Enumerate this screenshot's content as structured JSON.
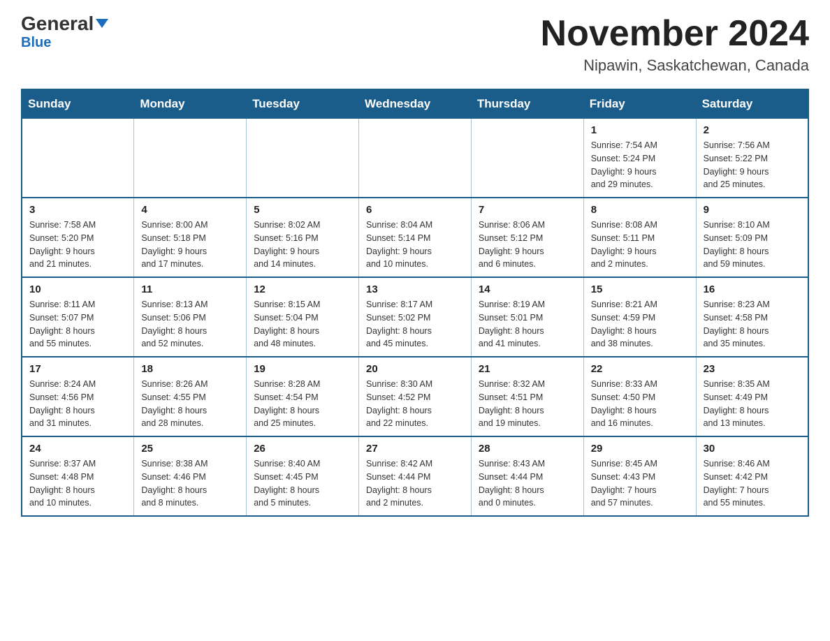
{
  "header": {
    "logo_general": "General",
    "logo_blue": "Blue",
    "month_title": "November 2024",
    "location": "Nipawin, Saskatchewan, Canada"
  },
  "days_of_week": [
    "Sunday",
    "Monday",
    "Tuesday",
    "Wednesday",
    "Thursday",
    "Friday",
    "Saturday"
  ],
  "weeks": [
    [
      {
        "day": "",
        "info": ""
      },
      {
        "day": "",
        "info": ""
      },
      {
        "day": "",
        "info": ""
      },
      {
        "day": "",
        "info": ""
      },
      {
        "day": "",
        "info": ""
      },
      {
        "day": "1",
        "info": "Sunrise: 7:54 AM\nSunset: 5:24 PM\nDaylight: 9 hours\nand 29 minutes."
      },
      {
        "day": "2",
        "info": "Sunrise: 7:56 AM\nSunset: 5:22 PM\nDaylight: 9 hours\nand 25 minutes."
      }
    ],
    [
      {
        "day": "3",
        "info": "Sunrise: 7:58 AM\nSunset: 5:20 PM\nDaylight: 9 hours\nand 21 minutes."
      },
      {
        "day": "4",
        "info": "Sunrise: 8:00 AM\nSunset: 5:18 PM\nDaylight: 9 hours\nand 17 minutes."
      },
      {
        "day": "5",
        "info": "Sunrise: 8:02 AM\nSunset: 5:16 PM\nDaylight: 9 hours\nand 14 minutes."
      },
      {
        "day": "6",
        "info": "Sunrise: 8:04 AM\nSunset: 5:14 PM\nDaylight: 9 hours\nand 10 minutes."
      },
      {
        "day": "7",
        "info": "Sunrise: 8:06 AM\nSunset: 5:12 PM\nDaylight: 9 hours\nand 6 minutes."
      },
      {
        "day": "8",
        "info": "Sunrise: 8:08 AM\nSunset: 5:11 PM\nDaylight: 9 hours\nand 2 minutes."
      },
      {
        "day": "9",
        "info": "Sunrise: 8:10 AM\nSunset: 5:09 PM\nDaylight: 8 hours\nand 59 minutes."
      }
    ],
    [
      {
        "day": "10",
        "info": "Sunrise: 8:11 AM\nSunset: 5:07 PM\nDaylight: 8 hours\nand 55 minutes."
      },
      {
        "day": "11",
        "info": "Sunrise: 8:13 AM\nSunset: 5:06 PM\nDaylight: 8 hours\nand 52 minutes."
      },
      {
        "day": "12",
        "info": "Sunrise: 8:15 AM\nSunset: 5:04 PM\nDaylight: 8 hours\nand 48 minutes."
      },
      {
        "day": "13",
        "info": "Sunrise: 8:17 AM\nSunset: 5:02 PM\nDaylight: 8 hours\nand 45 minutes."
      },
      {
        "day": "14",
        "info": "Sunrise: 8:19 AM\nSunset: 5:01 PM\nDaylight: 8 hours\nand 41 minutes."
      },
      {
        "day": "15",
        "info": "Sunrise: 8:21 AM\nSunset: 4:59 PM\nDaylight: 8 hours\nand 38 minutes."
      },
      {
        "day": "16",
        "info": "Sunrise: 8:23 AM\nSunset: 4:58 PM\nDaylight: 8 hours\nand 35 minutes."
      }
    ],
    [
      {
        "day": "17",
        "info": "Sunrise: 8:24 AM\nSunset: 4:56 PM\nDaylight: 8 hours\nand 31 minutes."
      },
      {
        "day": "18",
        "info": "Sunrise: 8:26 AM\nSunset: 4:55 PM\nDaylight: 8 hours\nand 28 minutes."
      },
      {
        "day": "19",
        "info": "Sunrise: 8:28 AM\nSunset: 4:54 PM\nDaylight: 8 hours\nand 25 minutes."
      },
      {
        "day": "20",
        "info": "Sunrise: 8:30 AM\nSunset: 4:52 PM\nDaylight: 8 hours\nand 22 minutes."
      },
      {
        "day": "21",
        "info": "Sunrise: 8:32 AM\nSunset: 4:51 PM\nDaylight: 8 hours\nand 19 minutes."
      },
      {
        "day": "22",
        "info": "Sunrise: 8:33 AM\nSunset: 4:50 PM\nDaylight: 8 hours\nand 16 minutes."
      },
      {
        "day": "23",
        "info": "Sunrise: 8:35 AM\nSunset: 4:49 PM\nDaylight: 8 hours\nand 13 minutes."
      }
    ],
    [
      {
        "day": "24",
        "info": "Sunrise: 8:37 AM\nSunset: 4:48 PM\nDaylight: 8 hours\nand 10 minutes."
      },
      {
        "day": "25",
        "info": "Sunrise: 8:38 AM\nSunset: 4:46 PM\nDaylight: 8 hours\nand 8 minutes."
      },
      {
        "day": "26",
        "info": "Sunrise: 8:40 AM\nSunset: 4:45 PM\nDaylight: 8 hours\nand 5 minutes."
      },
      {
        "day": "27",
        "info": "Sunrise: 8:42 AM\nSunset: 4:44 PM\nDaylight: 8 hours\nand 2 minutes."
      },
      {
        "day": "28",
        "info": "Sunrise: 8:43 AM\nSunset: 4:44 PM\nDaylight: 8 hours\nand 0 minutes."
      },
      {
        "day": "29",
        "info": "Sunrise: 8:45 AM\nSunset: 4:43 PM\nDaylight: 7 hours\nand 57 minutes."
      },
      {
        "day": "30",
        "info": "Sunrise: 8:46 AM\nSunset: 4:42 PM\nDaylight: 7 hours\nand 55 minutes."
      }
    ]
  ]
}
